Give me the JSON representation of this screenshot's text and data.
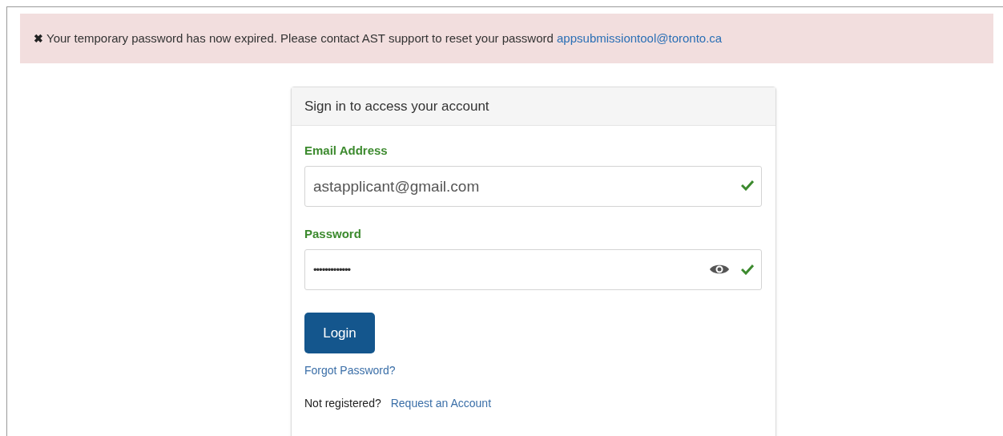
{
  "alert": {
    "symbol": "✖",
    "message": "Your temporary password has now expired. Please contact AST support to reset your password",
    "link": "appsubmissiontool@toronto.ca"
  },
  "card": {
    "title": "Sign in to access your account",
    "fields": [
      {
        "label": "Email Address",
        "value": "astapplicant@gmail.com",
        "kind": "email",
        "valid": true
      },
      {
        "label": "Password",
        "value": "•••••••••••••",
        "kind": "password",
        "valid": true
      }
    ],
    "button": "Login",
    "forgot_link": "Forgot Password?",
    "register_prompt": "Not registered?",
    "register_link": "Request an Account"
  }
}
